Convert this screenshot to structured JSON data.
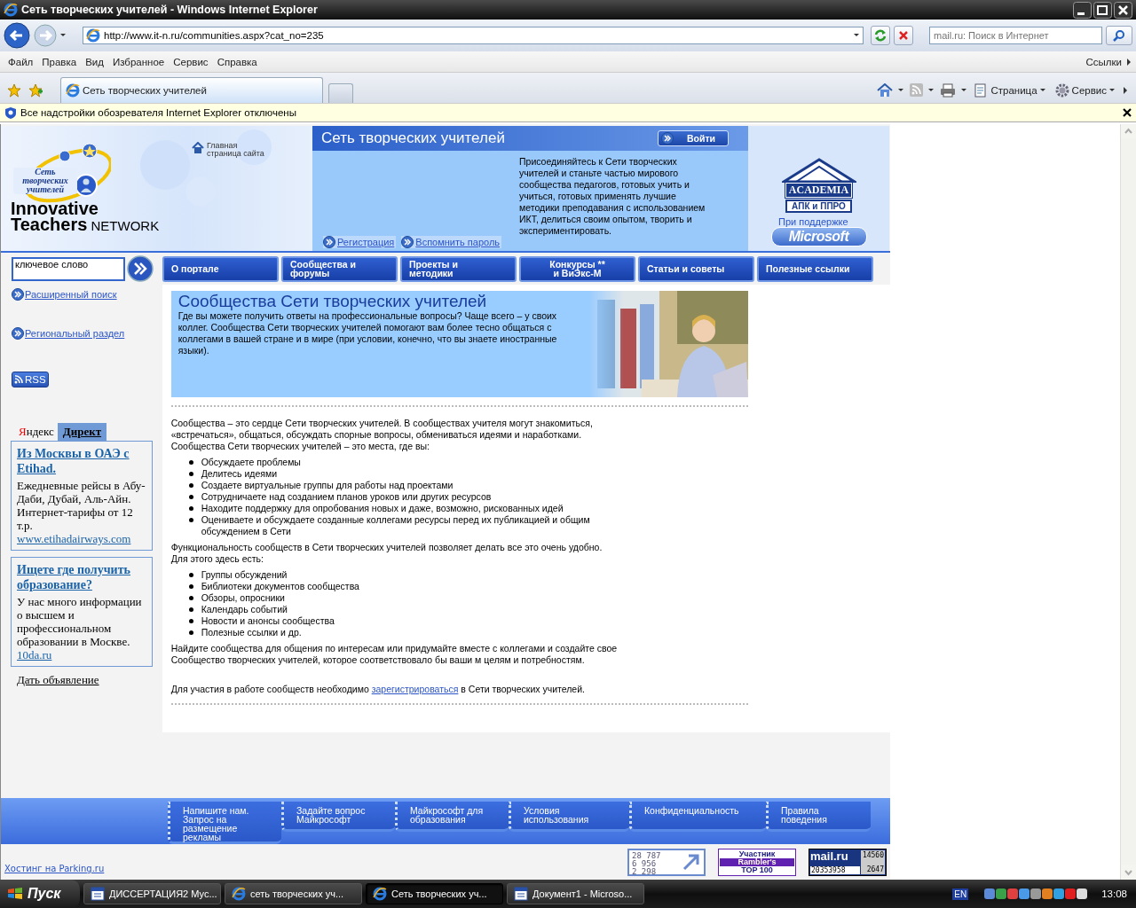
{
  "window": {
    "title": "Сеть творческих учителей - Windows Internet Explorer"
  },
  "address_bar": {
    "url": "http://www.it-n.ru/communities.aspx?cat_no=235"
  },
  "search_box": {
    "placeholder": "mail.ru: Поиск в Интернет"
  },
  "menu": [
    "Файл",
    "Правка",
    "Вид",
    "Избранное",
    "Сервис",
    "Справка"
  ],
  "links_label": "Ссылки",
  "tabs": [
    {
      "label": "Сеть творческих учителей",
      "selected": true
    }
  ],
  "command_bar": [
    "Страница",
    "Сервис"
  ],
  "info_bar": {
    "text": "Все надстройки обозревателя Internet Explorer отключены"
  },
  "site_header": {
    "logo_text": "Сеть творческих учителей",
    "brand": [
      "Innovative",
      "Teachers"
    ],
    "brand_suffix": "NETWORK",
    "home_link": "Главная страница сайта",
    "title": "Сеть творческих учителей",
    "login": "Войти",
    "intro": "Присоединяйтесь к Сети творческих учителей и станьте частью мирового сообщества педагогов, готовых учить и учиться, готовых применять лучшие методики преподавания с использованием ИКТ, делиться своим опытом, творить и экспериментировать.",
    "links": [
      "Регистрация",
      "Вспомнить пароль"
    ],
    "partner": {
      "name": "ACADEMIA",
      "subtitle": "АПК и ППРО"
    },
    "support_label": "При поддержке",
    "sponsor": "Microsoft"
  },
  "nav": {
    "search_value": "ключевое слово",
    "items": [
      {
        "label": "О портале",
        "centered": false
      },
      {
        "label": "Сообщества и\nфорумы",
        "centered": false
      },
      {
        "label": "Проекты и\nметодики",
        "centered": false
      },
      {
        "label": "Конкурсы **\nи ВиЭкс-М",
        "centered": true
      },
      {
        "label": "Статьи и советы",
        "centered": false
      },
      {
        "label": "Полезные ссылки",
        "centered": false
      }
    ]
  },
  "sidebar": {
    "links": [
      "Расширенный поиск",
      "Региональный раздел"
    ],
    "rss": "RSS",
    "direct": {
      "brand": "Яндекс",
      "tab": "Директ",
      "ads": [
        {
          "title": "Из Москвы в ОАЭ с Etihad.",
          "text": "Ежедневные рейсы в Абу-Даби, Дубай, Аль-Айн. Интернет-тарифы от 12 т.р.",
          "url": "www.etihadairways.com"
        },
        {
          "title": "Ищете где получить образование?",
          "text": "У нас много информации о высшем и профессиональном образовании в Москве.",
          "url": "10da.ru"
        }
      ],
      "post_ad": "Дать объявление"
    }
  },
  "article": {
    "banner": {
      "title": "Сообщества Сети творческих учителей",
      "text": "Где вы можете получить ответы на профессиональные вопросы? Чаще всего – у своих коллег. Сообщества Сети творческих учителей помогают вам более тесно общаться с коллегами в вашей стране и в мире (при условии, конечно, что вы знаете иностранные языки)."
    },
    "blocks": [
      {
        "kind": "paragraph",
        "text": "Сообщества – это сердце Сети творческих учителей. В сообществах учителя могут знакомиться, «встречаться», общаться, обсуждать спорные вопросы, обмениваться идеями и наработками. Сообщества Сети творческих учителей – это места, где вы:"
      },
      {
        "kind": "list",
        "items": [
          "Обсуждаете проблемы",
          "Делитесь идеями",
          "Создаете виртуальные группы для работы над проектами",
          "Сотрудничаете над созданием планов уроков или других ресурсов",
          "Находите поддержку для опробования новых и даже, возможно, рискованных идей",
          "Оцениваете и обсуждаете созданные коллегами ресурсы перед их публикацией и общим обсуждением в Сети"
        ]
      },
      {
        "kind": "paragraph",
        "text": "Функциональность сообществ в Сети творческих учителей позволяет делать все это очень удобно. Для этого здесь есть:"
      },
      {
        "kind": "list",
        "items": [
          "Группы обсуждений",
          "Библиотеки документов сообщества",
          "Обзоры, опросники",
          "Календарь событий",
          "Новости и анонсы сообщества",
          "Полезные ссылки и др."
        ]
      },
      {
        "kind": "paragraph",
        "text": "Найдите сообщества для общения по интересам или придумайте вместе с коллегами и создайте свое Сообщество творческих учителей, которое соответствовало бы ваши м целям и потребностям."
      },
      {
        "kind": "link_paragraph",
        "before": "Для участия в работе сообществ необходимо ",
        "link": "зарегистрироваться",
        "after": " в Сети творческих учителей."
      }
    ]
  },
  "footer": {
    "links": [
      "Напишите нам. Запрос на размещение рекламы",
      "Задайте вопрос Майкрософт",
      "Майкрософт для образования",
      "Условия использования",
      "Конфиденциальность",
      "Правила поведения"
    ],
    "hosting": "Хостинг на Parking.ru",
    "counters": {
      "liveinternet": [
        "28 787",
        "6 956",
        "2 298"
      ],
      "rambler": [
        "Участник",
        "Rambler's",
        "TOP 100"
      ],
      "mailru": {
        "logo": "mail.ru",
        "values": [
          "14560",
          "20353958",
          "2647"
        ]
      }
    }
  },
  "taskbar": {
    "start": "Пуск",
    "tasks": [
      {
        "label": "ДИССЕРТАЦИЯ2 Мус...",
        "kind": "document",
        "selected": false
      },
      {
        "label": "сеть творческих уч...",
        "kind": "browser",
        "selected": false
      },
      {
        "label": "Сеть творческих уч...",
        "kind": "browser",
        "selected": true
      },
      {
        "label": "Документ1 - Microso...",
        "kind": "document",
        "selected": false
      }
    ],
    "language": "EN",
    "clock": "13:08"
  }
}
